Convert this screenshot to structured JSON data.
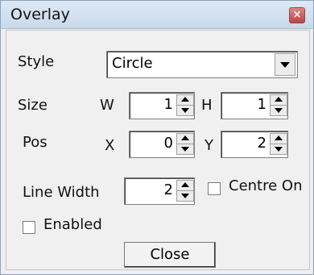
{
  "window": {
    "title": "Overlay"
  },
  "form": {
    "style_label": "Style",
    "style_value": "Circle",
    "size_label": "Size",
    "w_label": "W",
    "w_value": "1",
    "h_label": "H",
    "h_value": "1",
    "pos_label": "Pos",
    "x_label": "X",
    "x_value": "0",
    "y_label": "Y",
    "y_value": "2",
    "line_width_label": "Line Width",
    "line_width_value": "2",
    "centre_on_label": "Centre On",
    "centre_on_checked": false,
    "enabled_label": "Enabled",
    "enabled_checked": false
  },
  "buttons": {
    "close_label": "Close"
  },
  "icons": {
    "window_close": "close-icon",
    "dropdown": "chevron-down-icon",
    "spin_up": "triangle-up-icon",
    "spin_down": "triangle-down-icon"
  }
}
